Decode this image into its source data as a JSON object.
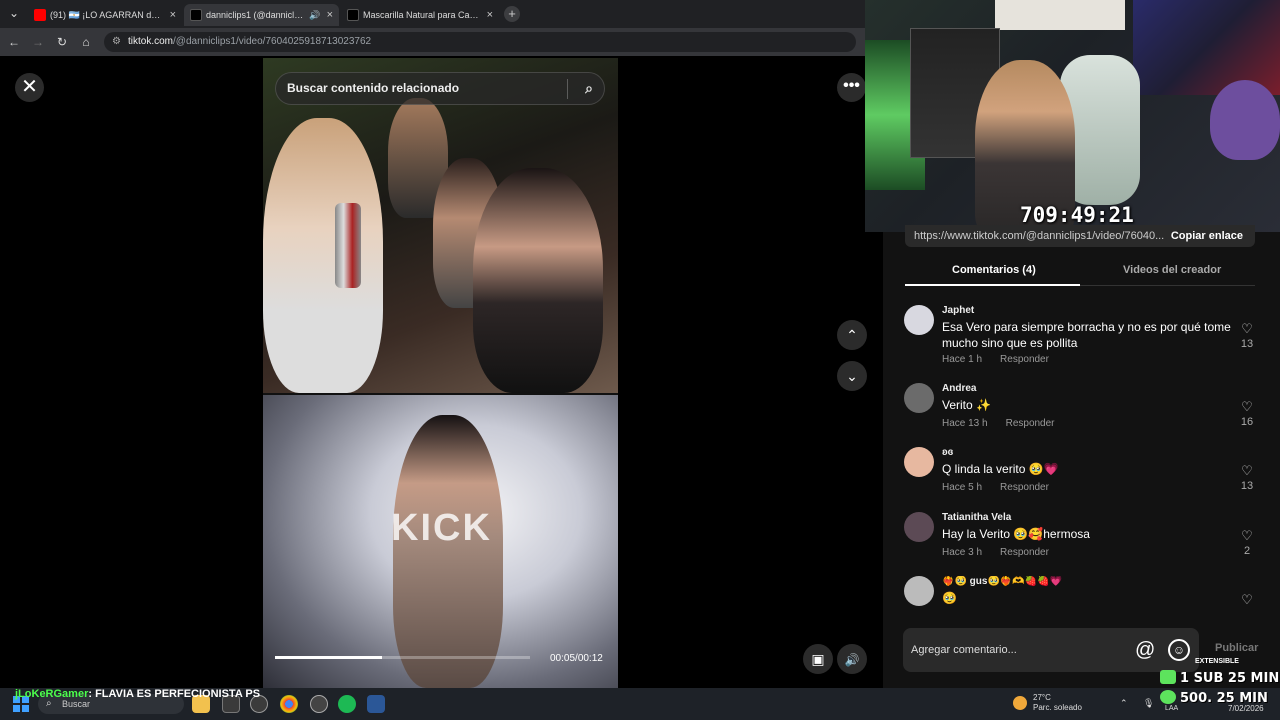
{
  "browser": {
    "tabs": [
      {
        "label": "(91) 🇦🇷 ¡LO AGARRAN de PIÑ...",
        "favicon_color": "#ff0000",
        "active": false
      },
      {
        "label": "danniclips1 (@danniclips1) |",
        "favicon_color": "#000000",
        "active": true
      },
      {
        "label": "Mascarilla Natural para Cabello",
        "favicon_color": "#000000",
        "active": false
      }
    ],
    "add_tab": "+",
    "url_host": "tiktok.com",
    "url_path": "/@danniclips1/video/7604025918713023762"
  },
  "video": {
    "search_placeholder": "Buscar contenido relacionado",
    "watermark": "KICK",
    "progress_fraction": 0.42,
    "time_current": "00:05",
    "time_total": "00:12"
  },
  "stream": {
    "timer": "709:49:21",
    "ticker_user": "jLoKeRGamer",
    "ticker_msg": ": FLAVIA ES PERFECIONISTA PS",
    "extensible": "EXTENSIBLE",
    "goal1": "1 SUB 25 MIN",
    "goal2": "500. 25 MIN"
  },
  "panel": {
    "link": "https://www.tiktok.com/@danniclips1/video/76040...",
    "copy_link": "Copiar enlace",
    "tab_comments": "Comentarios (4)",
    "tab_creator": "Videos del creador",
    "comments": [
      {
        "name": "Japhet",
        "text": "Esa Vero para siempre borracha y no es por qué tome mucho sino que es pollita",
        "time": "Hace 1 h",
        "reply": "Responder",
        "likes": "13",
        "avatar_color": "#d8d8e0"
      },
      {
        "name": "Andrea",
        "text": "Verito ✨",
        "time": "Hace 13 h",
        "reply": "Responder",
        "likes": "16",
        "avatar_color": "#6b6b6b"
      },
      {
        "name": "ʚɞ",
        "text": "Q linda la verito 🥹💗",
        "time": "Hace 5 h",
        "reply": "Responder",
        "likes": "13",
        "avatar_color": "#e7b8a0"
      },
      {
        "name": "Tatianitha Vela",
        "text": "Hay la Verito 🥹🥰hermosa",
        "time": "Hace 3 h",
        "reply": "Responder",
        "likes": "2",
        "avatar_color": "#5c4a55"
      },
      {
        "name": "❤️‍🔥🥹 gus🥹❤️‍🔥🫶🍓🍓💗",
        "text": "🥹",
        "time": "",
        "reply": "",
        "likes": "",
        "avatar_color": "#bbbbbb"
      }
    ],
    "compose_placeholder": "Agregar comentario...",
    "at_symbol": "@",
    "publish": "Publicar"
  },
  "taskbar": {
    "search": "Buscar",
    "weather_temp": "27°C",
    "weather_desc": "Parc. soleado",
    "lang": "LAA",
    "date": "7/02/2026"
  },
  "icons": {
    "close": "✕",
    "more": "•••",
    "up": "⌃",
    "down": "⌄",
    "search": "⌕",
    "volume": "🔊",
    "miniplayer": "▣",
    "heart": "♡"
  }
}
